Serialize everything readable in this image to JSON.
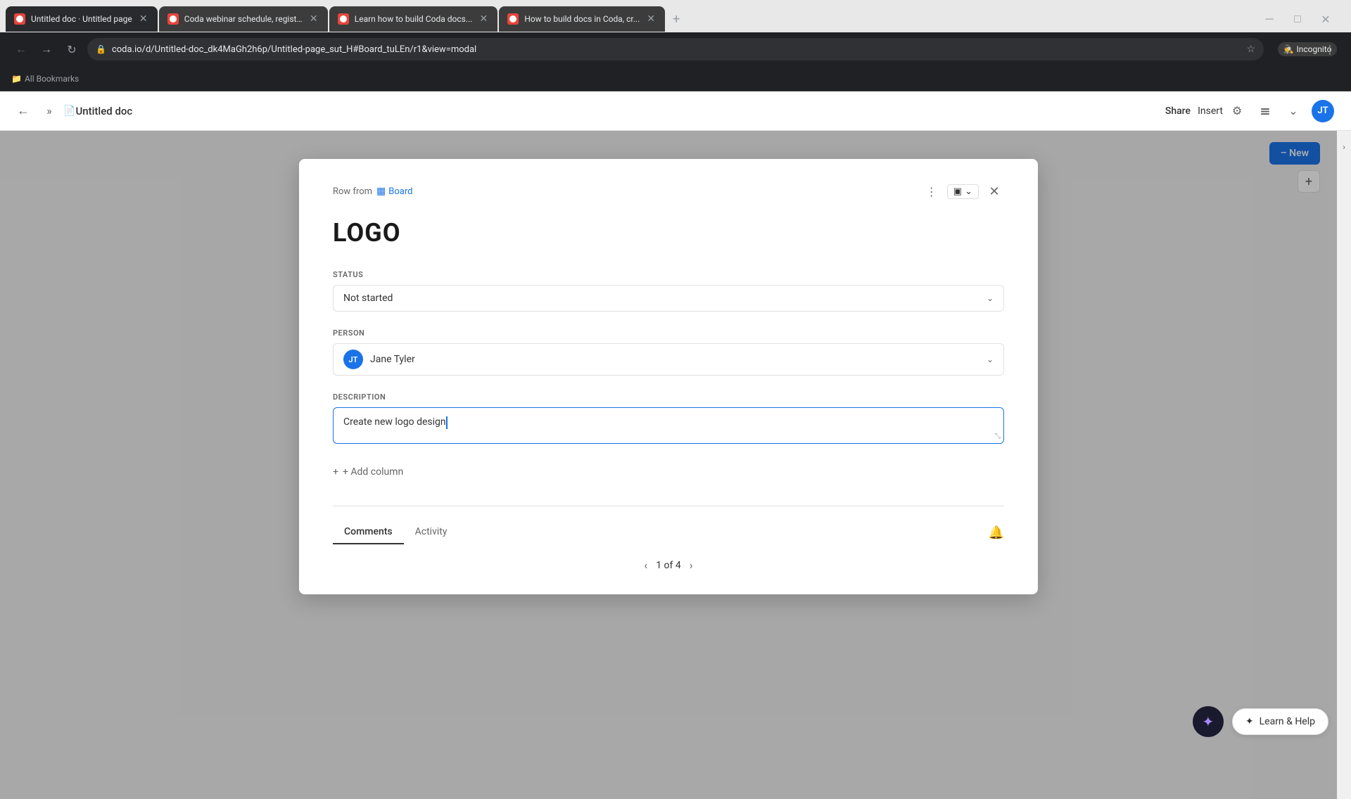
{
  "browser": {
    "tabs": [
      {
        "id": "tab1",
        "title": "Untitled doc · Untitled page",
        "favicon": "coda",
        "active": true
      },
      {
        "id": "tab2",
        "title": "Coda webinar schedule, regist...",
        "favicon": "coda",
        "active": false
      },
      {
        "id": "tab3",
        "title": "Learn how to build Coda docs...",
        "favicon": "coda",
        "active": false
      },
      {
        "id": "tab4",
        "title": "How to build docs in Coda, cr...",
        "favicon": "coda",
        "active": false
      }
    ],
    "url": "coda.io/d/Untitled-doc_dk4MaGh2h6p/Untitled-page_sut_H#Board_tuLEn/r1&view=modal",
    "incognito_label": "Incognito",
    "bookmarks_label": "All Bookmarks"
  },
  "app": {
    "doc_title": "Untitled doc",
    "back_label": "←",
    "share_label": "Share",
    "insert_label": "Insert"
  },
  "modal": {
    "row_from_label": "Row from",
    "board_label": "Board",
    "title": "LOGO",
    "status_label": "STATUS",
    "status_value": "Not started",
    "person_label": "PERSON",
    "person_name": "Jane Tyler",
    "person_initials": "JT",
    "description_label": "DESCRIPTION",
    "description_value": "Create new logo design",
    "add_column_label": "+ Add column",
    "comments_tab": "Comments",
    "activity_tab": "Activity",
    "pagination": "1 of 4",
    "page_prev": "‹",
    "page_next": "›"
  },
  "page": {
    "new_btn_label": "– New"
  },
  "bottom": {
    "learn_help_label": "Learn & Help"
  },
  "icons": {
    "more_icon": "⋮",
    "close_icon": "✕",
    "chevron_down": "⌄",
    "back_icon": "←",
    "forward_icon": "→",
    "reload_icon": "↻",
    "lock_icon": "🔒",
    "star_icon": "☆",
    "profile_icon": "⊕",
    "grid_icon": "⊞",
    "settings_icon": "⚙",
    "bell_icon": "🔔",
    "ai_star": "✦",
    "board_icon": "▦",
    "shield_icon": "🛡",
    "help_icon": "✦",
    "left_chevron": "‹",
    "right_chevron": "›",
    "plus_icon": "+",
    "sidebar_toggle": "»"
  }
}
